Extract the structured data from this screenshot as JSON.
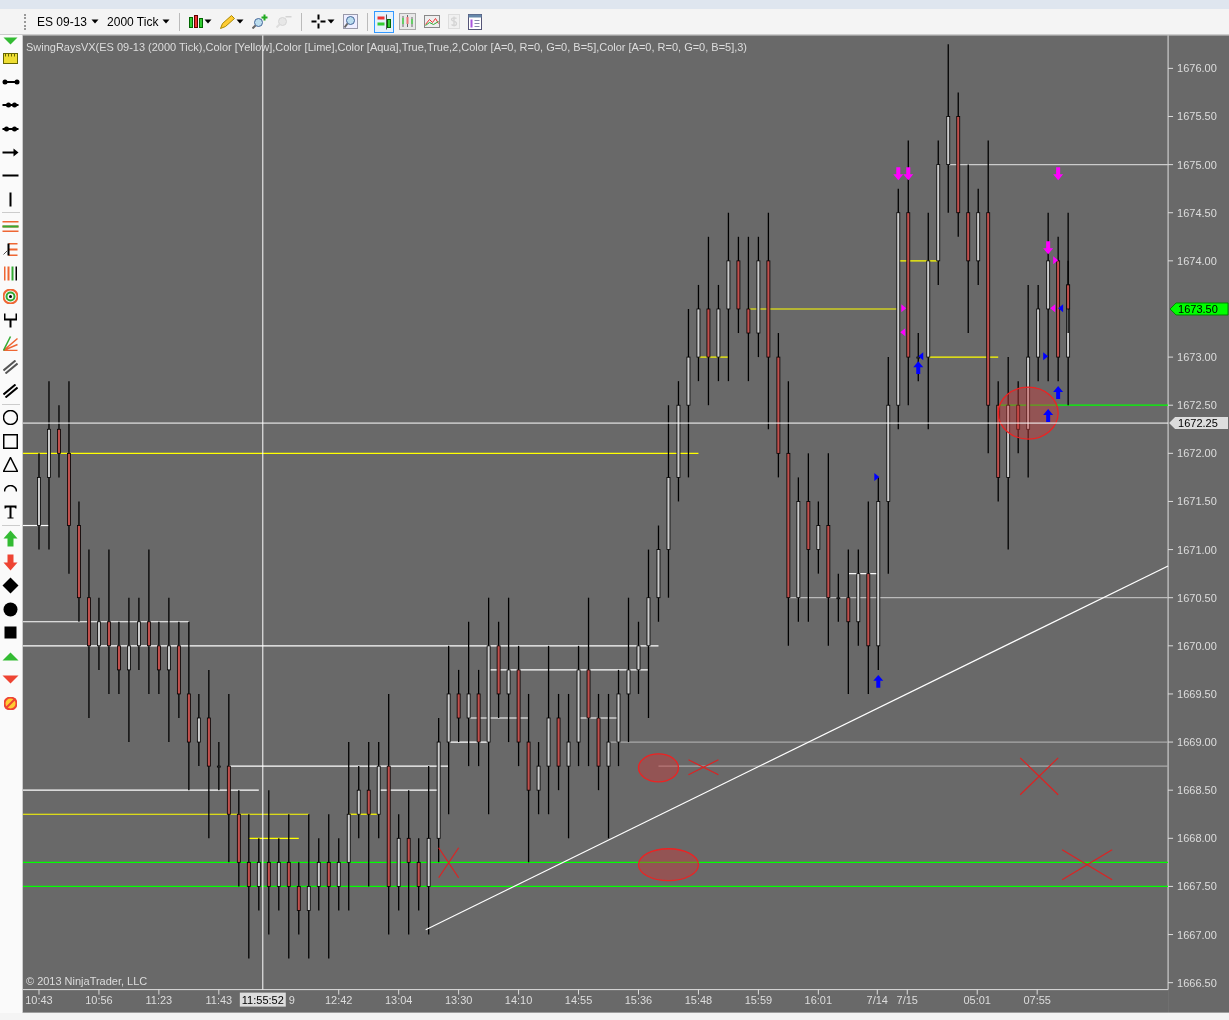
{
  "toolbar": {
    "instrument": "ES 09-13",
    "interval": "2000 Tick",
    "buttons": [
      {
        "kind": "bars",
        "selected": false,
        "disabled": false
      },
      {
        "kind": "pencil",
        "selected": false,
        "disabled": false
      },
      {
        "kind": "zoom-in",
        "selected": false,
        "disabled": false
      },
      {
        "kind": "zoom-out",
        "selected": false,
        "disabled": true
      },
      {
        "kind": "crosshair",
        "selected": false,
        "disabled": false
      },
      {
        "kind": "magnifier",
        "selected": false,
        "disabled": false
      },
      {
        "kind": "strategy",
        "selected": true,
        "disabled": false
      },
      {
        "kind": "framed-bars",
        "selected": false,
        "disabled": false
      },
      {
        "kind": "chart",
        "selected": false,
        "disabled": false
      },
      {
        "kind": "dollar",
        "selected": false,
        "disabled": true
      },
      {
        "kind": "panel",
        "selected": false,
        "disabled": false
      }
    ]
  },
  "chart": {
    "indicator_label": "SwingRaysVX(ES 09-13 (2000 Tick),Color [Yellow],Color [Lime],Color [Aqua],True,True,2,Color [A=0, R=0, G=0, B=5],Color [A=0, R=0, G=0, B=5],3)",
    "copyright": "© 2013 NinjaTrader, LLC",
    "y_axis_labels": [
      "1676.00",
      "1675.50",
      "1675.00",
      "1674.50",
      "1674.00",
      "1673.00",
      "1672.50",
      "1672.00",
      "1671.50",
      "1671.00",
      "1670.50",
      "1670.00",
      "1669.50",
      "1669.00",
      "1668.50",
      "1668.00",
      "1667.50",
      "1667.00",
      "1666.50"
    ],
    "x_axis_labels": [
      "10:43",
      "10:56",
      "11:23",
      "11:43",
      "9",
      "12:42",
      "13:04",
      "13:30",
      "14:10",
      "14:55",
      "15:36",
      "15:48",
      "15:59",
      "16:01",
      "7/14",
      "7/15",
      "05:01",
      "07:55"
    ],
    "last_price": "1673.50",
    "crosshair_price": "1672.25",
    "crosshair_time": "11:55:52"
  }
}
